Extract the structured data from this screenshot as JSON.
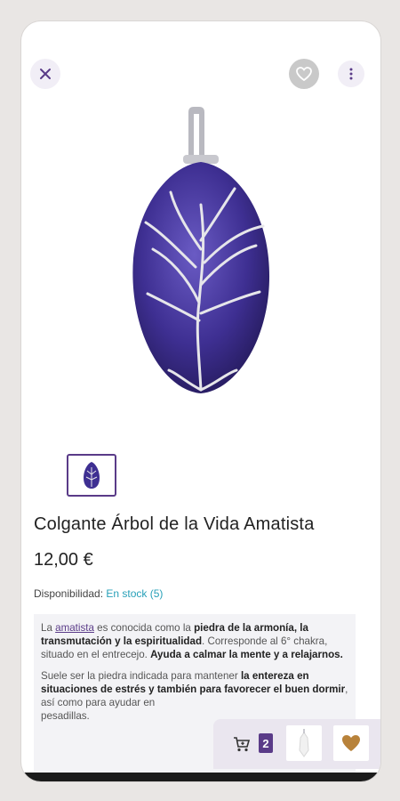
{
  "header": {
    "close_icon": "close-icon",
    "favorite_icon": "heart-icon",
    "menu_icon": "more-vertical-icon"
  },
  "product": {
    "title": "Colgante Árbol de la Vida Amatista",
    "price": "12,00 €",
    "availability_label": "Disponibilidad:",
    "stock_status": "En stock",
    "stock_count": "(5)"
  },
  "description": {
    "p1_a": "La ",
    "p1_link": "amatista",
    "p1_b": " es conocida como la ",
    "p1_bold1": "piedra de la armonía, la transmutación y la espiritualidad",
    "p1_c": ". Corresponde al 6° chakra, situado en el entrecejo. ",
    "p1_bold2": "Ayuda a calmar la mente y a relajarnos.",
    "p2_a": "Suele ser la piedra indicada para mantener ",
    "p2_bold": "la entereza en situaciones de estrés y también para favorecer el buen dormir",
    "p2_b": ", así como para ayudar en",
    "p2_c": "pesadillas."
  },
  "cart": {
    "count": "2",
    "icon": "cart-icon"
  },
  "colors": {
    "accent": "#5a3b88",
    "stock": "#27a0b8",
    "stone": "#3f2f8e"
  }
}
